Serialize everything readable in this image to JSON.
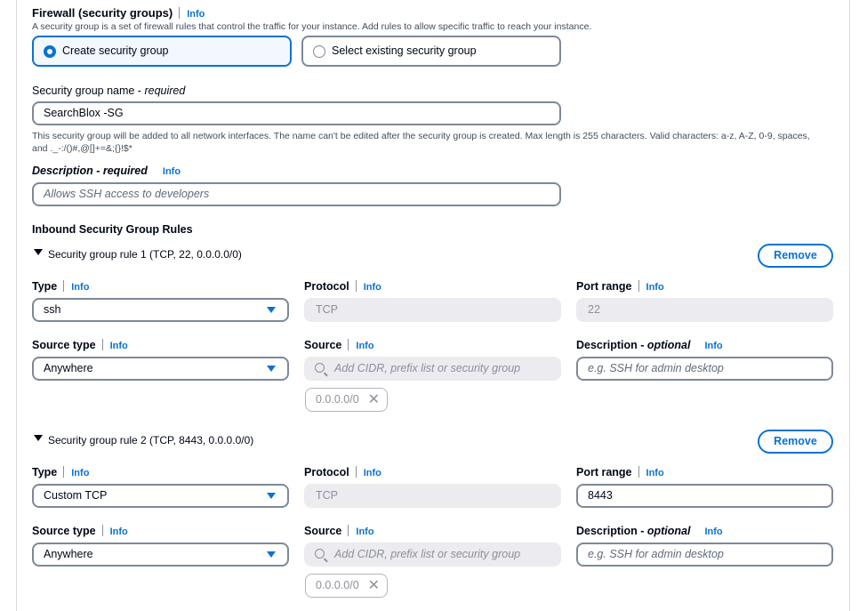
{
  "firewall": {
    "title": "Firewall (security groups)",
    "info": "Info",
    "description": "A security group is a set of firewall rules that control the traffic for your instance. Add rules to allow specific traffic to reach your instance.",
    "options": [
      "Create security group",
      "Select existing security group"
    ]
  },
  "sg_name": {
    "label": "Security group name - ",
    "label_required": "required",
    "value": "SearchBlox -SG",
    "help_line1": "This security group will be added to all network interfaces. The name can't be edited after the security group is created. Max length is 255 characters. Valid characters: a-z, A-Z, 0-9, spaces,",
    "help_line2": "and ._-:/()#,@[]+=&;{}!$*"
  },
  "sg_desc": {
    "label": "Description - required",
    "info": "Info",
    "placeholder": "Allows SSH access to developers"
  },
  "inbound": {
    "title": "Inbound Security Group Rules",
    "labels": {
      "type": "Type",
      "protocol": "Protocol",
      "port_range": "Port range",
      "source_type": "Source type",
      "source": "Source",
      "description": "Description - ",
      "description_optional": "optional",
      "info": "Info",
      "remove": "Remove",
      "source_placeholder": "Add CIDR, prefix list or security group",
      "desc_placeholder": "e.g. SSH for admin desktop"
    },
    "rules": [
      {
        "title": "Security group rule 1 (TCP, 22, 0.0.0.0/0)",
        "type": "ssh",
        "protocol": "TCP",
        "port_range": "22",
        "source_type": "Anywhere",
        "source_token": "0.0.0.0/0"
      },
      {
        "title": "Security group rule 2 (TCP, 8443, 0.0.0.0/0)",
        "type": "Custom TCP",
        "protocol": "TCP",
        "port_range": "8443",
        "source_type": "Anywhere",
        "source_token": "0.0.0.0/0"
      }
    ]
  },
  "colors": {
    "accent": "#0972d3",
    "text": "#000716",
    "border": "#7d8998",
    "disabled_bg": "#ebebf0"
  }
}
